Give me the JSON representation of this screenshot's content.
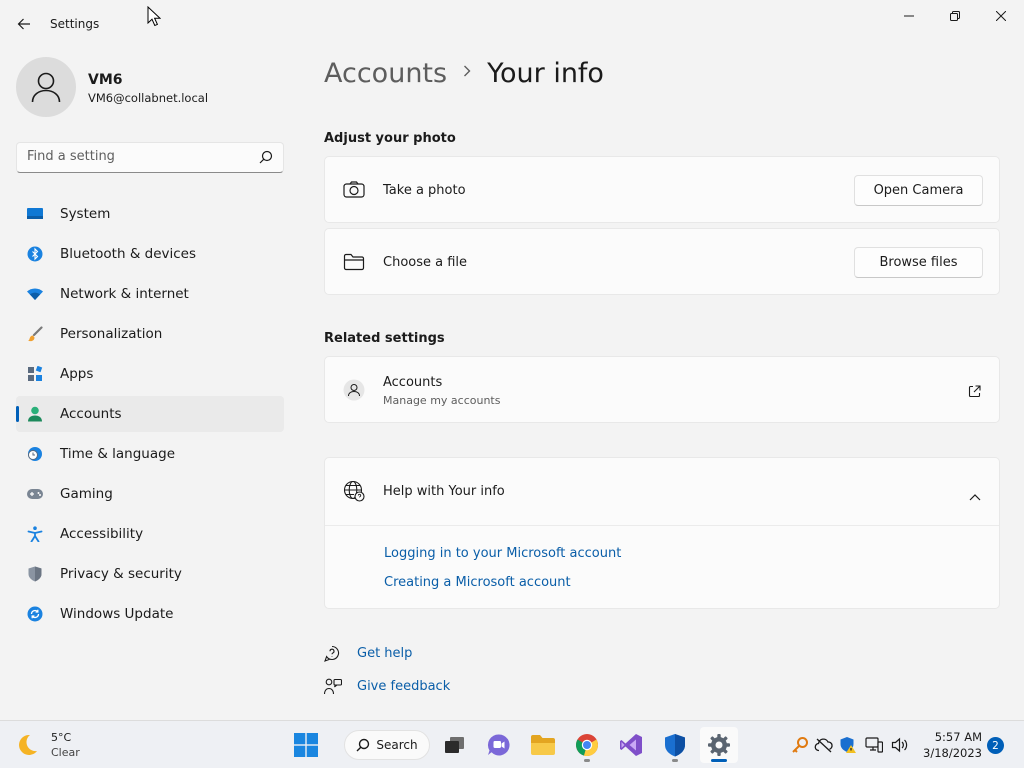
{
  "window": {
    "title": "Settings"
  },
  "profile": {
    "name": "VM6",
    "email": "VM6@collabnet.local"
  },
  "search": {
    "placeholder": "Find a setting"
  },
  "nav": {
    "items": [
      {
        "label": "System",
        "icon": "system-icon"
      },
      {
        "label": "Bluetooth & devices",
        "icon": "bluetooth-icon"
      },
      {
        "label": "Network & internet",
        "icon": "wifi-icon"
      },
      {
        "label": "Personalization",
        "icon": "brush-icon"
      },
      {
        "label": "Apps",
        "icon": "apps-icon"
      },
      {
        "label": "Accounts",
        "icon": "account-icon",
        "active": true
      },
      {
        "label": "Time & language",
        "icon": "clock-globe-icon"
      },
      {
        "label": "Gaming",
        "icon": "gamepad-icon"
      },
      {
        "label": "Accessibility",
        "icon": "accessibility-icon"
      },
      {
        "label": "Privacy & security",
        "icon": "shield-icon"
      },
      {
        "label": "Windows Update",
        "icon": "update-icon"
      }
    ]
  },
  "breadcrumb": {
    "parent": "Accounts",
    "current": "Your info"
  },
  "adjust_photo": {
    "title": "Adjust your photo",
    "take_photo": {
      "label": "Take a photo",
      "button": "Open Camera"
    },
    "choose_file": {
      "label": "Choose a file",
      "button": "Browse files"
    }
  },
  "related": {
    "title": "Related settings",
    "accounts": {
      "label": "Accounts",
      "sublabel": "Manage my accounts"
    }
  },
  "help": {
    "title": "Help with Your info",
    "links": [
      "Logging in to your Microsoft account",
      "Creating a Microsoft account"
    ]
  },
  "footer_links": {
    "get_help": "Get help",
    "give_feedback": "Give feedback"
  },
  "taskbar": {
    "weather": {
      "temp": "5°C",
      "condition": "Clear"
    },
    "search_label": "Search",
    "clock": {
      "time": "5:57 AM",
      "date": "3/18/2023"
    },
    "notification_count": "2"
  },
  "colors": {
    "accent": "#005fb8",
    "link": "#0a5ea8"
  }
}
